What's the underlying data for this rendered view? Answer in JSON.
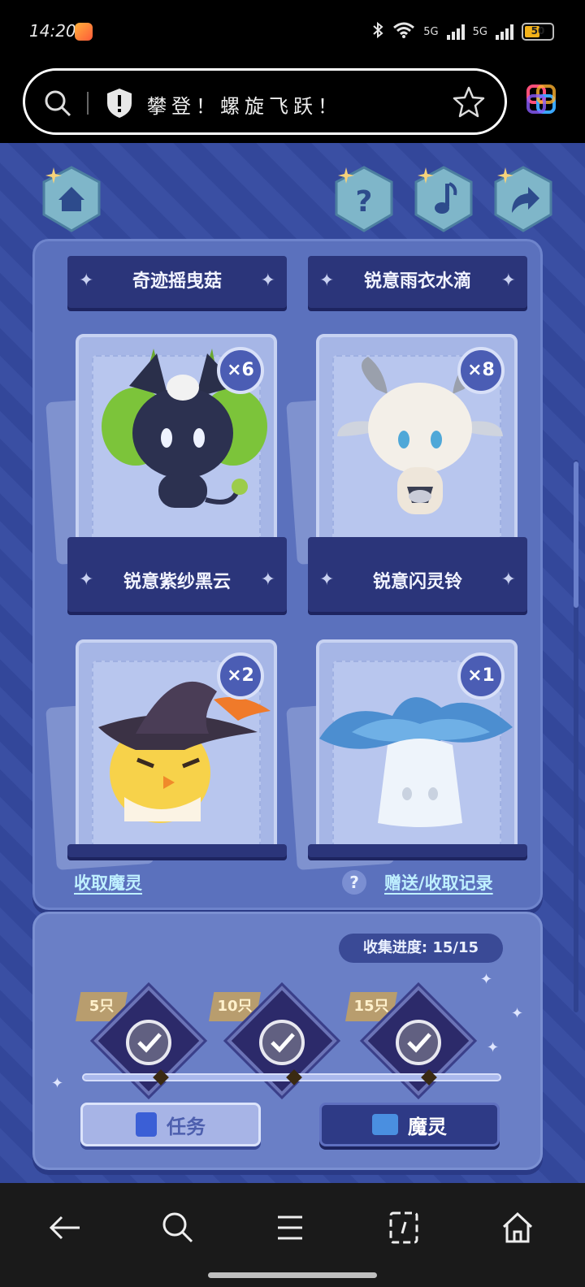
{
  "status_bar": {
    "time": "14:20",
    "signal_1": "5G",
    "signal_2": "5G",
    "battery": "50"
  },
  "browser": {
    "url_text": "攀登！螺旋飞跃！"
  },
  "game": {
    "cards_top": [
      {
        "name": "奇迹摇曳菇"
      },
      {
        "name": "锐意雨衣水滴"
      }
    ],
    "cards_middle": [
      {
        "name": "锐意紫纱黑云",
        "count": "×6"
      },
      {
        "name": "锐意闪灵铃",
        "count": "×8"
      }
    ],
    "cards_bottom": [
      {
        "count": "×2"
      },
      {
        "count": "×1"
      }
    ],
    "links": {
      "collect": "收取魔灵",
      "help": "?",
      "records": "赠送/收取记录"
    },
    "progress": {
      "label": "收集进度:  15/15",
      "milestones": [
        "5只",
        "10只",
        "15只"
      ]
    },
    "buttons": {
      "task": "任务",
      "spirit": "魔灵"
    }
  }
}
